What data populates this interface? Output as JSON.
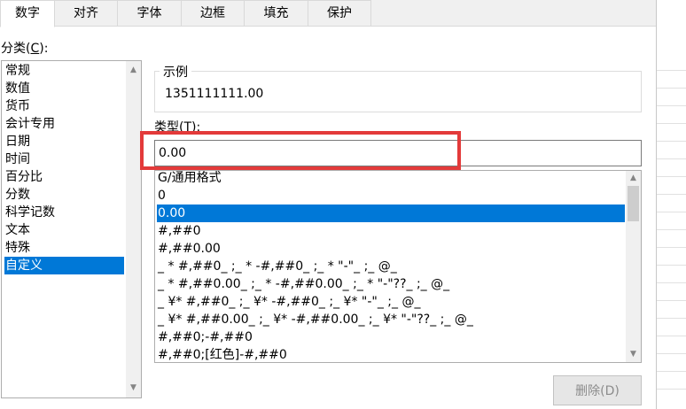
{
  "tabs": [
    {
      "label": "数字",
      "active": true
    },
    {
      "label": "对齐"
    },
    {
      "label": "字体"
    },
    {
      "label": "边框"
    },
    {
      "label": "填充"
    },
    {
      "label": "保护"
    }
  ],
  "category": {
    "label": "分类(C):",
    "label_prefix": "分类(",
    "label_key": "C",
    "label_suffix": "):",
    "items": [
      "常规",
      "数值",
      "货币",
      "会计专用",
      "日期",
      "时间",
      "百分比",
      "分数",
      "科学记数",
      "文本",
      "特殊",
      "自定义"
    ],
    "selected": "自定义"
  },
  "sample": {
    "legend": "示例",
    "value": "1351111111.00"
  },
  "type": {
    "label": "类型(T):",
    "value": "0.00"
  },
  "formats": {
    "items": [
      "G/通用格式",
      "0",
      "0.00",
      "#,##0",
      "#,##0.00",
      "_ * #,##0_ ;_ * -#,##0_ ;_ * \"-\"_ ;_ @_",
      "_ * #,##0.00_ ;_ * -#,##0.00_ ;_ * \"-\"??_ ;_ @_",
      "_ ¥* #,##0_ ;_ ¥* -#,##0_ ;_ ¥* \"-\"_ ;_ @_",
      "_ ¥* #,##0.00_ ;_ ¥* -#,##0.00_ ;_ ¥* \"-\"??_ ;_ @_",
      "#,##0;-#,##0",
      "#,##0;[红色]-#,##0"
    ],
    "selected": "0.00"
  },
  "buttons": {
    "delete": "删除(D)"
  },
  "colors": {
    "selection": "#0078d7",
    "highlight_box": "#e33a3a"
  }
}
